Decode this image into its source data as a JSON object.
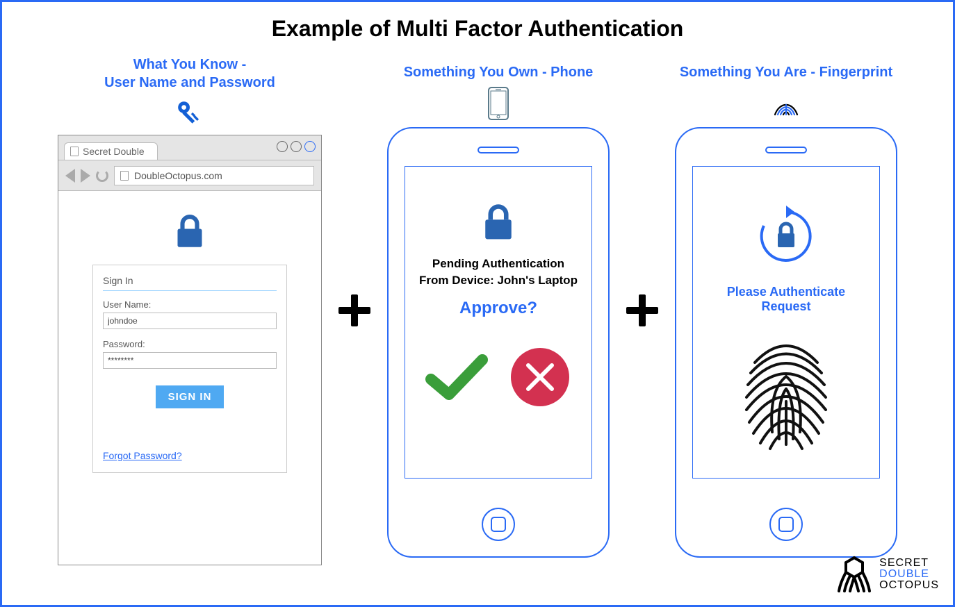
{
  "title": "Example of Multi Factor Authentication",
  "factor1": {
    "heading_line1": "What You Know -",
    "heading_line2": "User Name and Password",
    "browser": {
      "tab_title": "Secret Double",
      "url": "DoubleOctopus.com",
      "signin_title": "Sign In",
      "username_label": "User Name:",
      "username_value": "johndoe",
      "password_label": "Password:",
      "password_value": "********",
      "signin_button": "SIGN IN",
      "forgot_link": "Forgot Password?"
    }
  },
  "factor2": {
    "heading": "Something You Own - Phone",
    "pending_line1": "Pending Authentication",
    "pending_line2": "From Device: John's Laptop",
    "approve_label": "Approve?"
  },
  "factor3": {
    "heading": "Something You Are - Fingerprint",
    "auth_text": "Please Authenticate Request"
  },
  "brand": {
    "line1": "SECRET",
    "line2": "DOUBLE",
    "line3": "OCTOPUS"
  }
}
